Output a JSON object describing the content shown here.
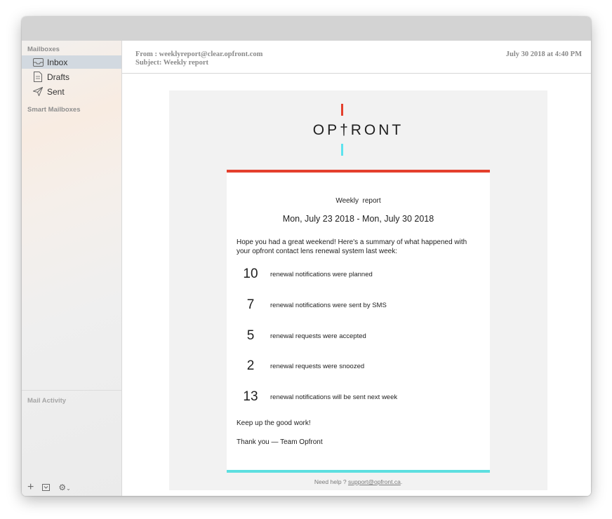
{
  "sidebar": {
    "mailboxes_heading": "Mailboxes",
    "items": [
      {
        "label": "Inbox",
        "icon": "inbox-icon"
      },
      {
        "label": "Drafts",
        "icon": "drafts-icon"
      },
      {
        "label": "Sent",
        "icon": "sent-icon"
      }
    ],
    "smart_mailboxes_heading": "Smart Mailboxes",
    "mail_activity_heading": "Mail Activity",
    "bottom_icons": [
      "add-icon",
      "mailbox-icon",
      "gear-icon"
    ]
  },
  "message_header": {
    "from": "From : weeklyreport@clear.opfront.com",
    "subject": "Subject: Weekly report",
    "date": "July 30 2018 at 4:40 PM"
  },
  "email": {
    "logo_text": "OP†RONT",
    "title": "Weekly  report",
    "date_range": "Mon, July 23 2018 - Mon, July 30 2018",
    "intro": "Hope you had a great weekend! Here's a summary of what happened with your opfront contact lens renewal system last week:",
    "stats": [
      {
        "number": "10",
        "text": "renewal notifications were planned"
      },
      {
        "number": "7",
        "text": "renewal notifications were sent by SMS"
      },
      {
        "number": "5",
        "text": "renewal requests were accepted"
      },
      {
        "number": "2",
        "text": "renewal requests were snoozed"
      },
      {
        "number": "13",
        "text": "renewal notifications will be sent next week"
      }
    ],
    "closing": "Keep up the good work!",
    "signoff": "Thank you — Team Opfront",
    "help_prefix": "Need help ? ",
    "help_email": "support@opfront.ca",
    "help_suffix": ".",
    "colors": {
      "accent_red": "#e4402d",
      "accent_cyan": "#5ddfe0"
    }
  }
}
